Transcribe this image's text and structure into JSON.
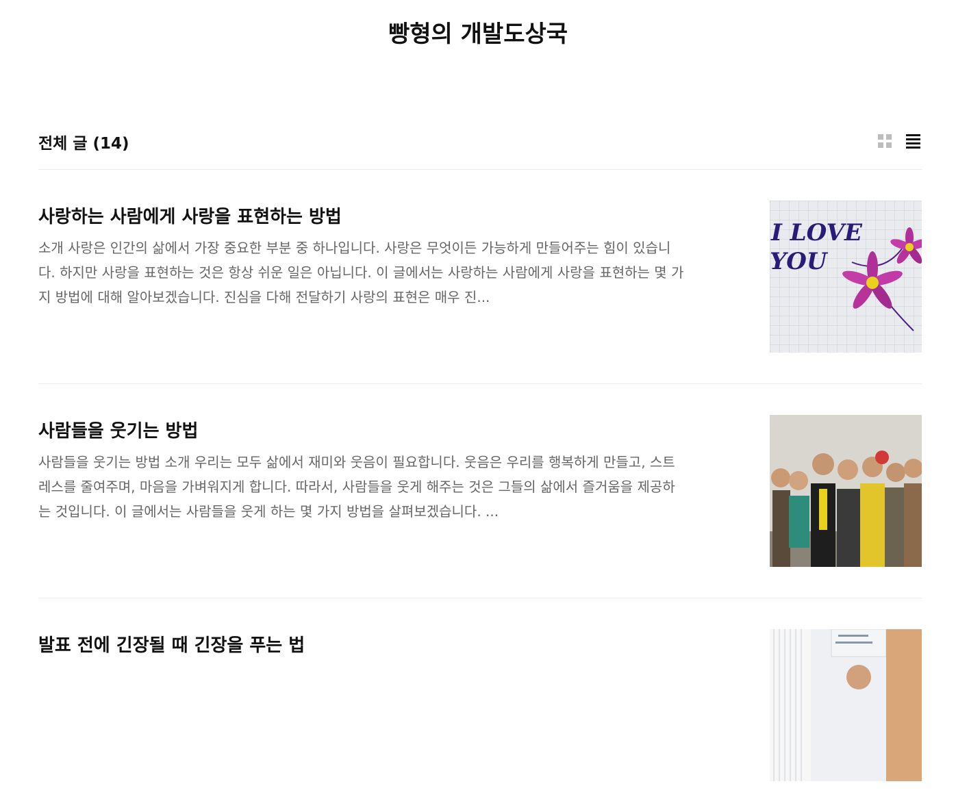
{
  "blog": {
    "title": "빵형의 개발도상국"
  },
  "list_header": {
    "label": "전체 글 (14)"
  },
  "view_toggle": {
    "grid_icon": "grid-icon",
    "list_icon": "list-icon",
    "active": "list"
  },
  "posts": [
    {
      "title": "사랑하는 사람에게 사랑을 표현하는 방법",
      "excerpt": "소개 사랑은 인간의 삶에서 가장 중요한 부분 중 하나입니다. 사랑은 무엇이든 가능하게 만들어주는 힘이 있습니다. 하지만 사랑을 표현하는 것은 항상 쉬운 일은 아닙니다. 이 글에서는 사랑하는 사람에게 사랑을 표현하는 몇 가지 방법에 대해 알아보겠습니다. 진심을 다해 전달하기 사랑의 표현은 매우 진...",
      "thumb_text_1": "I LOVE",
      "thumb_text_2": "YOU"
    },
    {
      "title": "사람들을 웃기는 방법",
      "excerpt": "사람들을 웃기는 방법 소개 우리는 모두 삶에서 재미와 웃음이 필요합니다. 웃음은 우리를 행복하게 만들고, 스트레스를 줄여주며, 마음을 가벼워지게 합니다. 따라서, 사람들을 웃게 해주는 것은 그들의 삶에서 즐거움을 제공하는 것입니다. 이 글에서는 사람들을 웃게 하는 몇 가지 방법을 살펴보겠습니다. ..."
    },
    {
      "title": "발표 전에 긴장될 때 긴장을 푸는 법",
      "excerpt": ""
    }
  ]
}
